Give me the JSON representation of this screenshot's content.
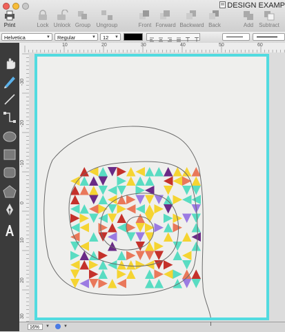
{
  "toolbar": {
    "print_label": "Print",
    "lock_label": "Lock",
    "unlock_label": "Unlock",
    "group_label": "Group",
    "ungroup_label": "Ungroup",
    "front_label": "Front",
    "forward_label": "Forward",
    "backward_label": "Backward",
    "back_label": "Back",
    "add_label": "Add",
    "subtract_label": "Subtract"
  },
  "document": {
    "title": "DESIGN EXAMP"
  },
  "format": {
    "font_family": "Helvetica",
    "font_style": "Regular",
    "font_size": "12",
    "text_color": "#000000"
  },
  "rulers": {
    "horizontal_ticks": [
      "10",
      "20",
      "30",
      "40",
      "50",
      "60"
    ],
    "vertical_ticks": [
      "-30",
      "-20",
      "-10",
      "0",
      "10",
      "20",
      "30"
    ]
  },
  "status": {
    "zoom": "16%"
  },
  "colors": {
    "page_border": "#52dbe0",
    "yellow": "#f5d432",
    "teal": "#59dcc2",
    "red": "#c4312b",
    "purple": "#9b7be2",
    "dark_purple": "#6a2a86",
    "orange": "#e9785a"
  }
}
